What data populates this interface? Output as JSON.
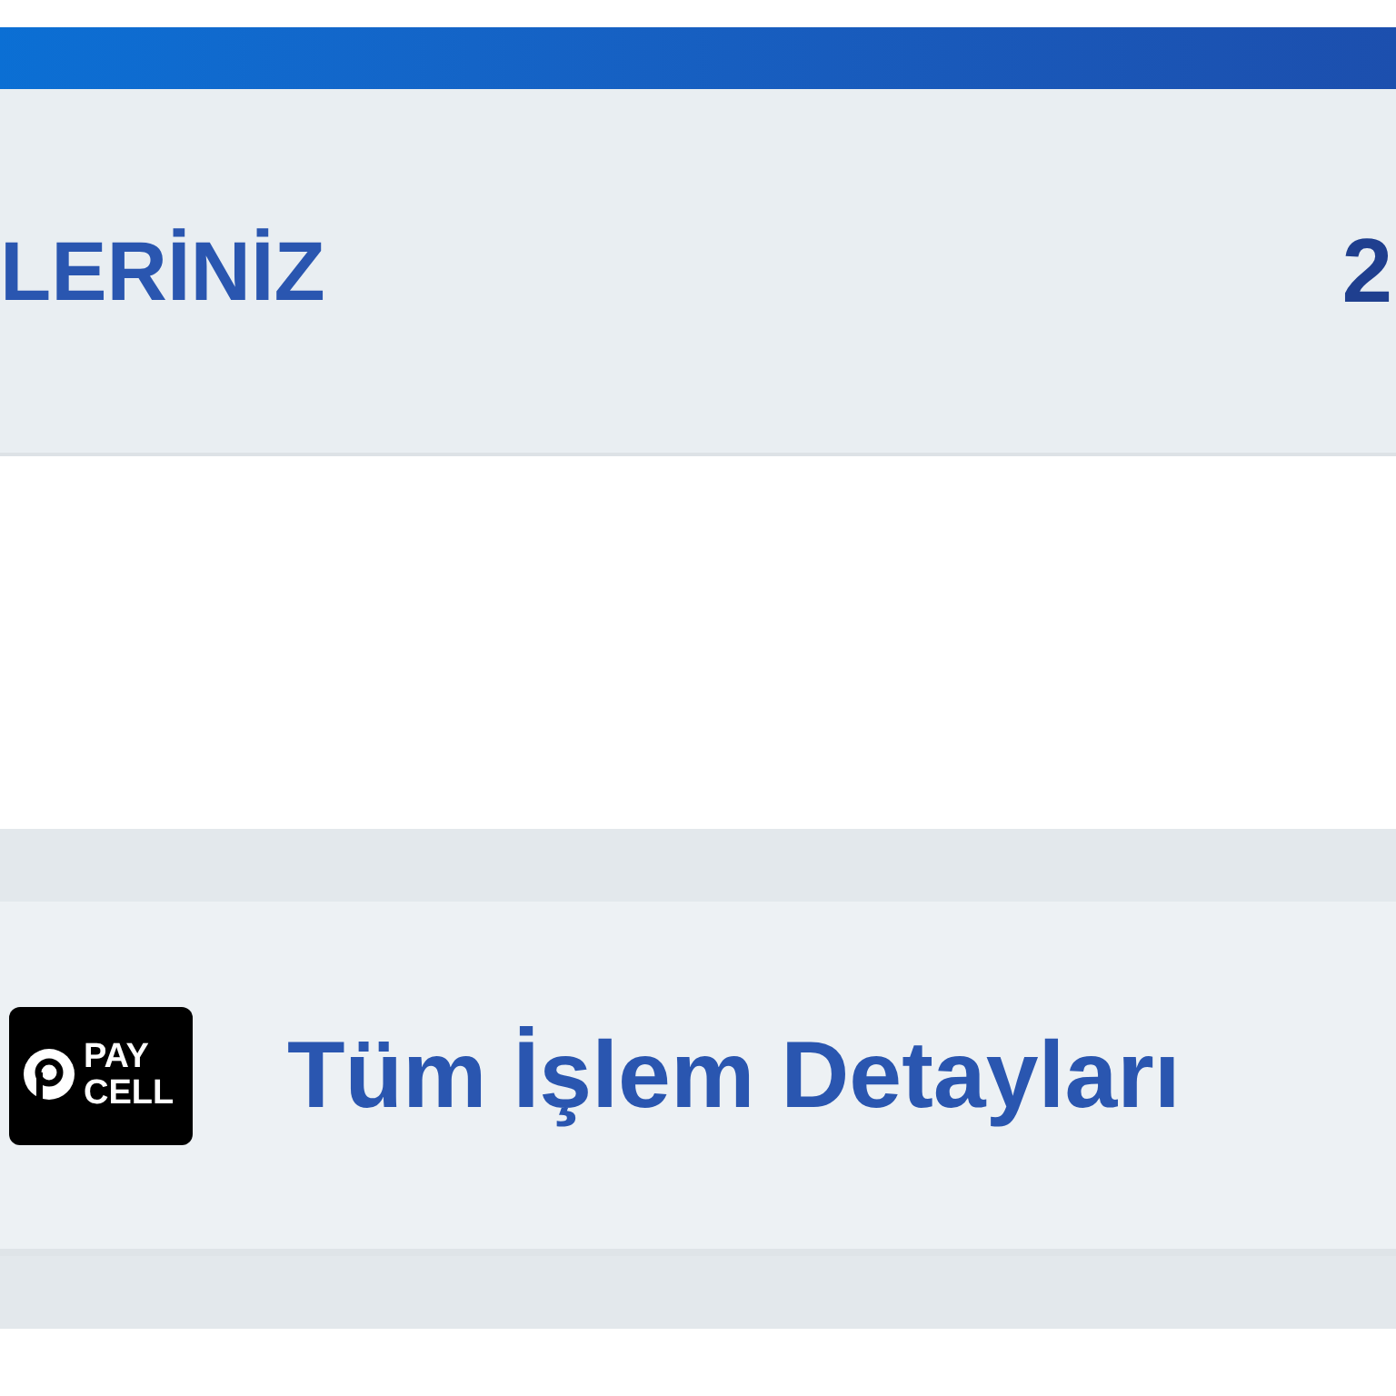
{
  "header": {
    "title": "LERİNİZ",
    "value": "2"
  },
  "detail_row": {
    "logo": {
      "line1": "PAY",
      "line2": "CELL"
    },
    "label": "Tüm İşlem Detayları"
  }
}
